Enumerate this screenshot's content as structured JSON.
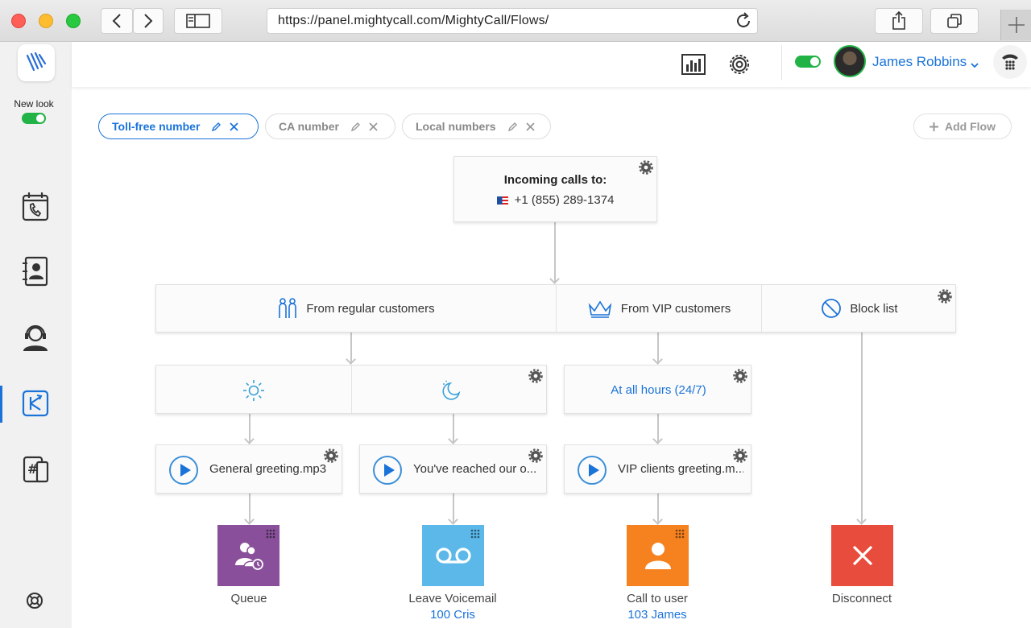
{
  "browser": {
    "url": "https://panel.mightycall.com/MightyCall/Flows/"
  },
  "sidebar": {
    "new_look_label": "New look",
    "items": [
      {
        "name": "calls",
        "icon": "calendar-phone-icon"
      },
      {
        "name": "contacts",
        "icon": "contact-book-icon"
      },
      {
        "name": "support",
        "icon": "headset-agent-icon"
      },
      {
        "name": "flows",
        "icon": "flows-icon",
        "active": true
      },
      {
        "name": "numbers",
        "icon": "hash-phone-icon"
      }
    ]
  },
  "header": {
    "user_name": "James Robbins",
    "status_online": true
  },
  "tabs": [
    {
      "label": "Toll-free number",
      "active": true
    },
    {
      "label": "CA number",
      "active": false
    },
    {
      "label": "Local numbers",
      "active": false
    }
  ],
  "add_flow_label": "Add Flow",
  "flow": {
    "incoming": {
      "title": "Incoming calls to:",
      "number": "+1 (855) 289-1374"
    },
    "filters": {
      "regular": "From regular customers",
      "vip": "From VIP customers",
      "block": "Block list"
    },
    "hours": {
      "all_hours": "At all hours (24/7)"
    },
    "greetings": {
      "general": "General greeting.mp3",
      "reached": "You've reached our o...",
      "vip": "VIP clients greeting.m..."
    },
    "actions": [
      {
        "label": "Queue",
        "sub": "",
        "color": "#8a4f9a"
      },
      {
        "label": "Leave Voicemail",
        "sub": "100 Cris",
        "color": "#5bb8e8"
      },
      {
        "label": "Call to user",
        "sub": "103 James",
        "color": "#f6821f"
      },
      {
        "label": "Disconnect",
        "sub": "",
        "color": "#e84c3d"
      }
    ]
  },
  "colors": {
    "accent": "#1a73d9",
    "online_green": "#21b345"
  }
}
